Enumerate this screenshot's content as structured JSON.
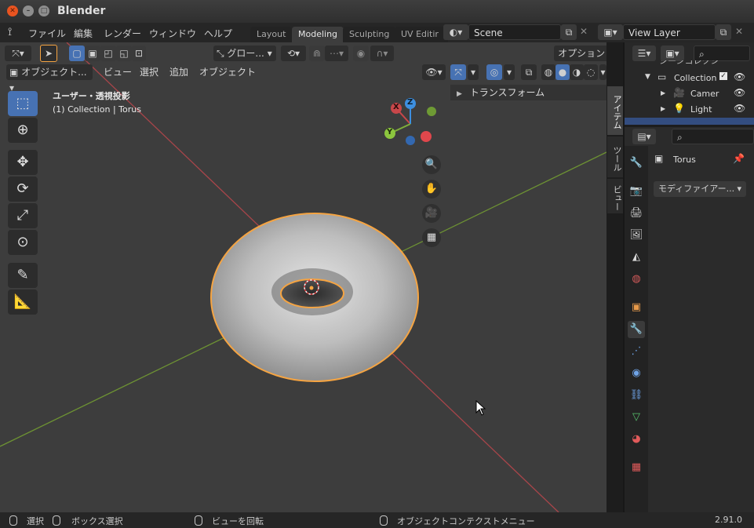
{
  "window": {
    "title": "Blender"
  },
  "menu": {
    "items": [
      "ファイル",
      "編集",
      "レンダー",
      "ウィンドウ",
      "ヘルプ"
    ]
  },
  "workspaces": {
    "tabs": [
      "Layout",
      "Modeling",
      "Sculpting",
      "UV Editir"
    ],
    "active": "Modeling"
  },
  "scene": {
    "name": "Scene"
  },
  "view_layer": {
    "name": "View Layer"
  },
  "toolheader": {
    "transform_orientation": "グロー...",
    "options_label": "オプション"
  },
  "viewport_header": {
    "mode": "オブジェクト...",
    "menus": [
      "ビュー",
      "選択",
      "追加",
      "オブジェクト"
    ]
  },
  "viewport": {
    "view_label": "ユーザー・透視投影",
    "object_label": "(1) Collection | Torus",
    "gizmo_axes": [
      "X",
      "Y",
      "Z"
    ],
    "sidebar_panel": "トランスフォーム",
    "side_tabs": [
      "アイテム",
      "ツール",
      "ビュー"
    ]
  },
  "outliner": {
    "partial_header": "シーンコレクシ",
    "items": [
      {
        "label": "Collection"
      },
      {
        "label": "Camer"
      },
      {
        "label": "Light"
      }
    ]
  },
  "properties": {
    "object_name": "Torus",
    "modifier_dropdown": "モディファイアー..."
  },
  "statusbar": {
    "select": "選択",
    "box_select": "ボックス選択",
    "rotate_view": "ビューを回転",
    "context_menu": "オブジェクトコンテクストメニュー",
    "version": "2.91.0"
  },
  "colors": {
    "accent_blue": "#4772b3",
    "selection_orange": "#f5a442",
    "axis_x": "#c8474a",
    "axis_y": "#7fae3a",
    "axis_z": "#3d8fe0"
  }
}
